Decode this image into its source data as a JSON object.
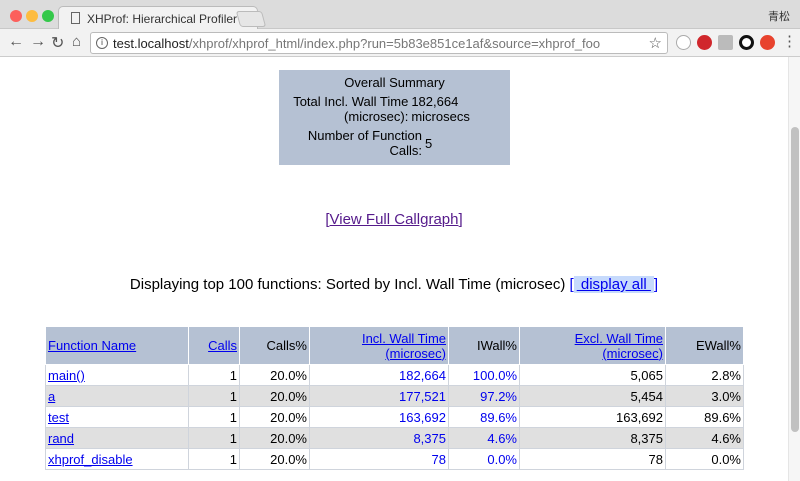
{
  "browser": {
    "tab_title": "XHProf: Hierarchical Profiler Re",
    "user": "青松",
    "url_host": "test.localhost",
    "url_path": "/xhprof/xhprof_html/index.php?run=5b83e851ce1af&source=xhprof_foo",
    "extension_icons": [
      "ghostery-icon",
      "adblock-plus-icon",
      "reader-icon",
      "circle-icon",
      "red-extension-icon"
    ]
  },
  "summary": {
    "title": "Overall Summary",
    "rows": [
      {
        "label": "Total Incl. Wall Time (microsec):",
        "value": "182,664 microsecs"
      },
      {
        "label": "Number of Function Calls:",
        "value": "5"
      }
    ]
  },
  "callgraph": {
    "open": "[",
    "link": "View Full Callgraph",
    "close": "]"
  },
  "heading": {
    "text": "Displaying top 100 functions: Sorted by Incl. Wall Time (microsec) ",
    "open": "[",
    "link": " display all ",
    "close": "]"
  },
  "table": {
    "headers": [
      "Function Name",
      "Calls",
      "Calls%",
      "Incl. Wall Time (microsec)",
      "IWall%",
      "Excl. Wall Time (microsec)",
      "EWall%"
    ],
    "rows": [
      [
        "main()",
        "1",
        "20.0%",
        "182,664",
        "100.0%",
        "5,065",
        "2.8%"
      ],
      [
        "a",
        "1",
        "20.0%",
        "177,521",
        "97.2%",
        "5,454",
        "3.0%"
      ],
      [
        "test",
        "1",
        "20.0%",
        "163,692",
        "89.6%",
        "163,692",
        "89.6%"
      ],
      [
        "rand",
        "1",
        "20.0%",
        "8,375",
        "4.6%",
        "8,375",
        "4.6%"
      ],
      [
        "xhprof_disable",
        "1",
        "20.0%",
        "78",
        "0.0%",
        "78",
        "0.0%"
      ]
    ]
  },
  "colors": {
    "header_bg": "#b5c1d3",
    "link": "#0000ee",
    "alt_row": "#e0e0e0"
  }
}
